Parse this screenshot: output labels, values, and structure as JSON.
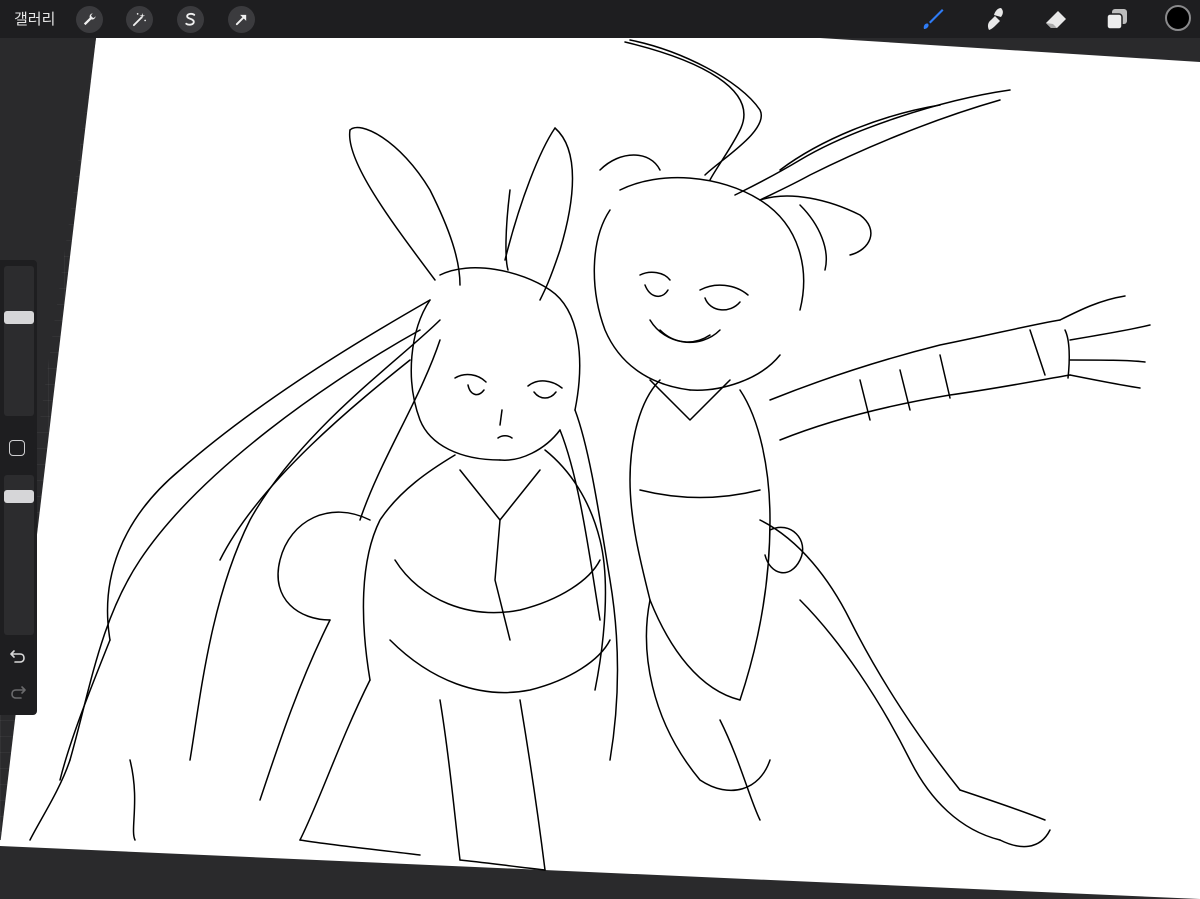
{
  "topbar": {
    "gallery_label": "갤러리",
    "left_tools": [
      {
        "name": "wrench-icon",
        "purpose": "actions"
      },
      {
        "name": "magic-wand-icon",
        "purpose": "adjustments"
      },
      {
        "name": "selection-s-icon",
        "purpose": "selection"
      },
      {
        "name": "arrow-cursor-icon",
        "purpose": "transform"
      }
    ],
    "right_tools": [
      {
        "name": "brush-icon",
        "active": true
      },
      {
        "name": "smudge-icon",
        "active": false
      },
      {
        "name": "eraser-icon",
        "active": false
      },
      {
        "name": "layers-icon",
        "active": false
      }
    ],
    "current_color": "#000000",
    "active_tool_color": "#2f7cf6"
  },
  "sidebar": {
    "brush_size_level": 0.67,
    "opacity_level": 0.9,
    "icons": [
      "modify-square-icon",
      "undo-icon",
      "redo-icon"
    ]
  },
  "canvas": {
    "background": "#ffffff",
    "stroke_color": "#000000"
  }
}
